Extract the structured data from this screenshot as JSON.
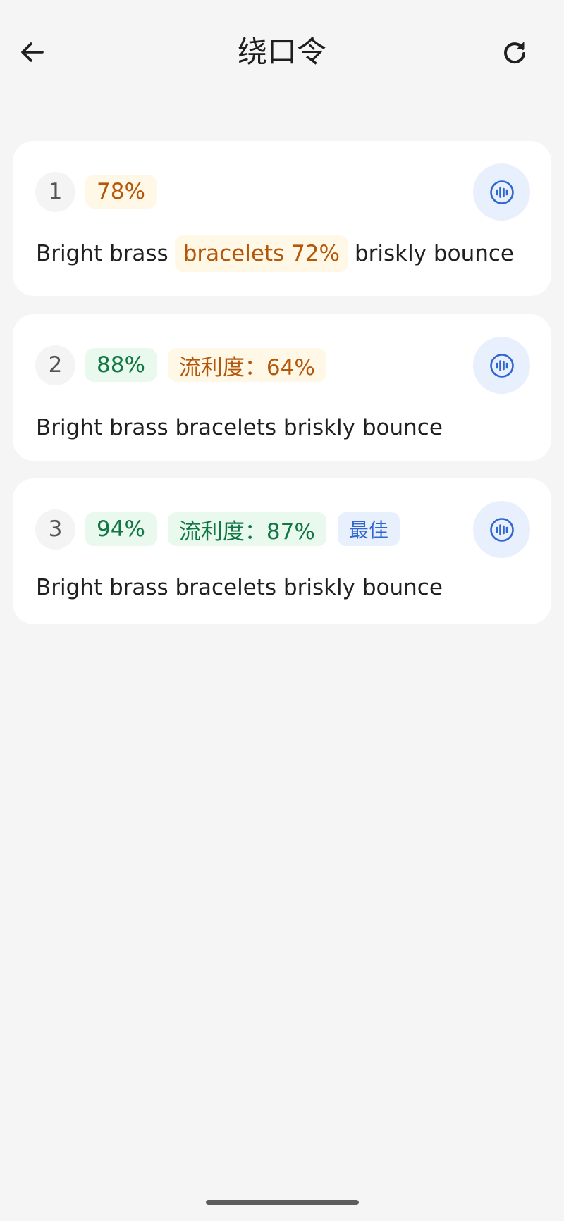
{
  "header": {
    "title": "绕口令",
    "back_icon": "arrow-left-icon",
    "refresh_icon": "refresh-icon"
  },
  "colors": {
    "background": "#f5f5f5",
    "card": "#ffffff",
    "amber_text": "#b4570a",
    "amber_bg": "#fff8e6",
    "green_text": "#127744",
    "green_bg": "#e9f9ee",
    "blue_text": "#2f66d0",
    "blue_bg": "#e8f0fe"
  },
  "attempts": [
    {
      "number": "1",
      "score": "78%",
      "sentence_before": "Bright brass",
      "highlight": "bracelets 72%",
      "sentence_after": "briskly bounce",
      "play_icon": "audio-wave-icon"
    },
    {
      "number": "2",
      "score": "88%",
      "fluency": "流利度：64%",
      "sentence": "Bright brass bracelets briskly bounce",
      "play_icon": "audio-wave-icon"
    },
    {
      "number": "3",
      "score": "94%",
      "fluency": "流利度：87%",
      "badge": "最佳",
      "sentence": "Bright brass bracelets briskly bounce",
      "play_icon": "audio-wave-icon"
    }
  ]
}
